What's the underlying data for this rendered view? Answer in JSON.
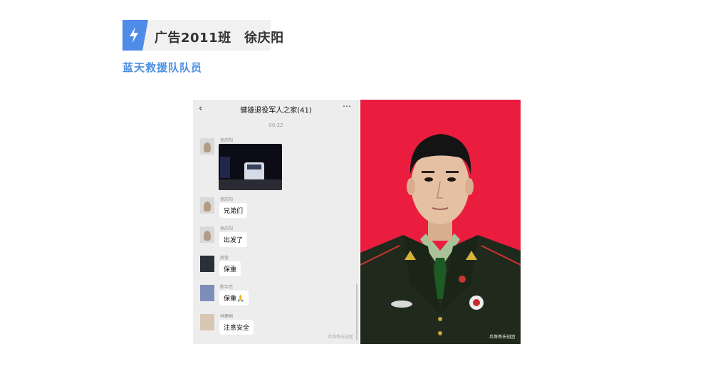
{
  "header": {
    "icon": "lightning-icon",
    "title": "广告2011班　徐庆阳",
    "subtitle": "蓝天救援队队员",
    "accent_color": "#4f8be8"
  },
  "chat": {
    "title": "健雄退役军人之家(41)",
    "time": "00:22",
    "messages": [
      {
        "sender": "徐庆阳",
        "type": "image"
      },
      {
        "sender": "徐庆阳",
        "text": "兄弟们"
      },
      {
        "sender": "徐庆阳",
        "text": "出发了"
      },
      {
        "sender": "房俊",
        "text": "保重"
      },
      {
        "sender": "陈宇杰",
        "text": "保重🙏"
      },
      {
        "sender": "林建桐",
        "text": "注意安全"
      }
    ],
    "watermark": "兵哥哥乐创团"
  },
  "portrait": {
    "background_color": "#ea1d3f",
    "watermark": "兵哥哥乐创团"
  }
}
